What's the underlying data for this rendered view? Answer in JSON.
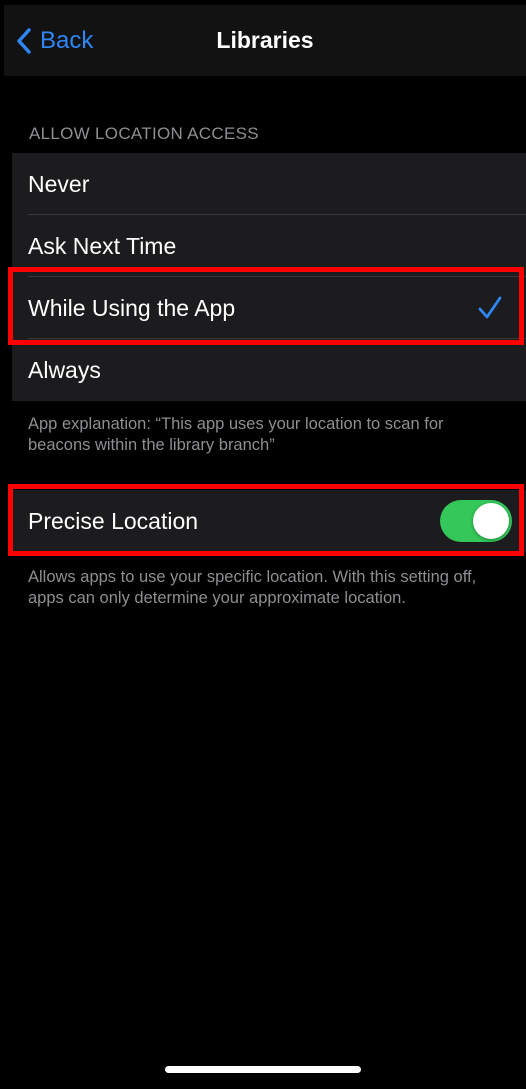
{
  "navbar": {
    "back_label": "Back",
    "title": "Libraries"
  },
  "location_access": {
    "header": "ALLOW LOCATION ACCESS",
    "options": [
      {
        "label": "Never",
        "selected": false
      },
      {
        "label": "Ask Next Time",
        "selected": false
      },
      {
        "label": "While Using the App",
        "selected": true
      },
      {
        "label": "Always",
        "selected": false
      }
    ],
    "explanation": "App explanation: “This app uses your location to scan for beacons within the library branch”"
  },
  "precise_location": {
    "label": "Precise Location",
    "enabled": true,
    "description": "Allows apps to use your specific location. With this setting off, apps can only determine your approximate location."
  },
  "icons": {
    "back": "chevron-left-icon",
    "selected": "checkmark-icon"
  },
  "colors": {
    "accent": "#2f86f6",
    "toggle_on": "#34c759",
    "highlight": "#ff0000",
    "cell_background": "#1c1c1e",
    "secondary_text": "#8e8e93"
  }
}
